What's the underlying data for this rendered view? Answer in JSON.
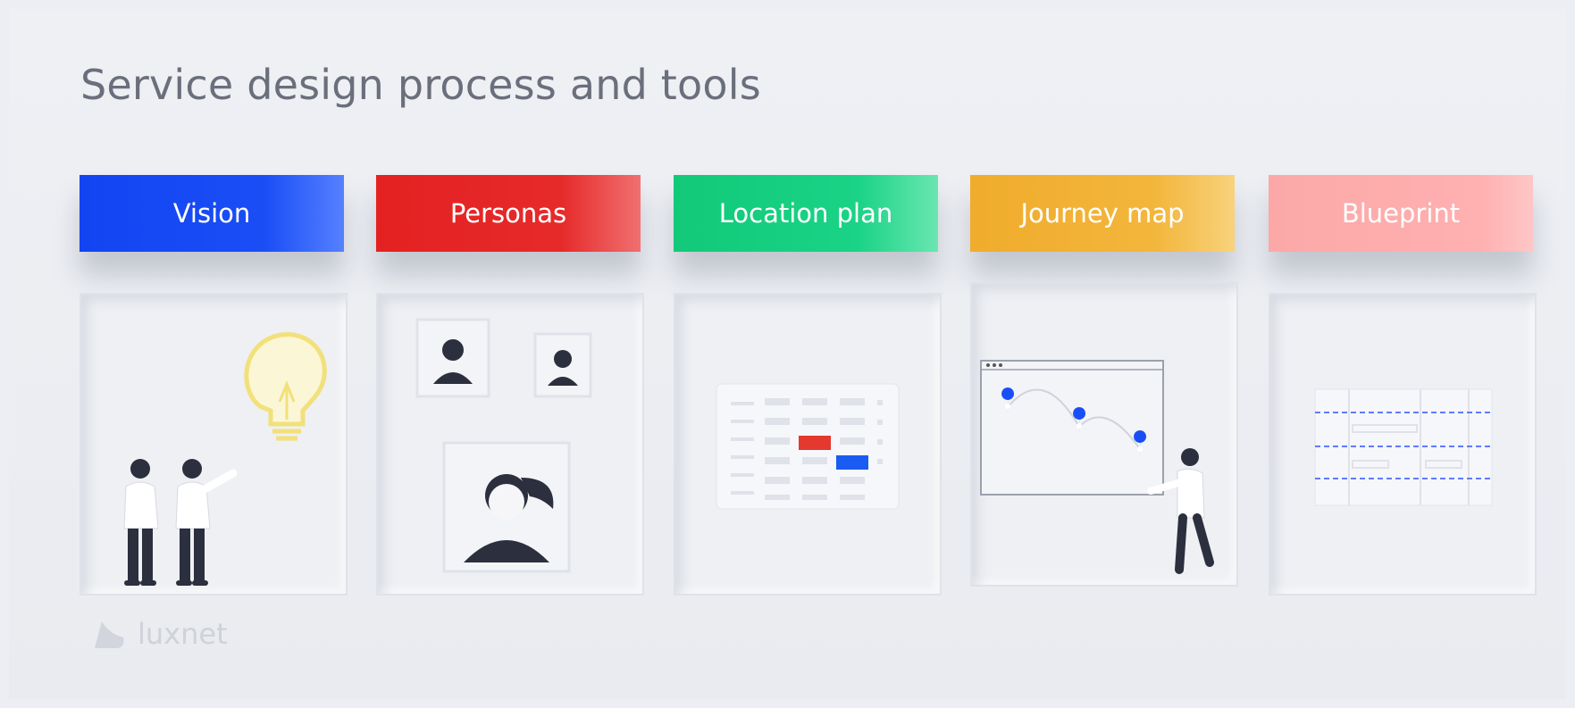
{
  "title": "Service design process and tools",
  "stages": [
    {
      "label": "Vision",
      "color": "#1a4ef5",
      "icon": "lightbulb-people-icon"
    },
    {
      "label": "Personas",
      "color": "#e62a2a",
      "icon": "persona-avatars-icon"
    },
    {
      "label": "Location plan",
      "color": "#1ad386",
      "icon": "floor-plan-grid-icon"
    },
    {
      "label": "Journey map",
      "color": "#f3b63c",
      "icon": "journey-map-pins-icon"
    },
    {
      "label": "Blueprint",
      "color": "#ffb0b0",
      "icon": "blueprint-table-icon"
    }
  ],
  "brand": {
    "name": "luxnet",
    "icon": "luxnet-logo-icon"
  }
}
